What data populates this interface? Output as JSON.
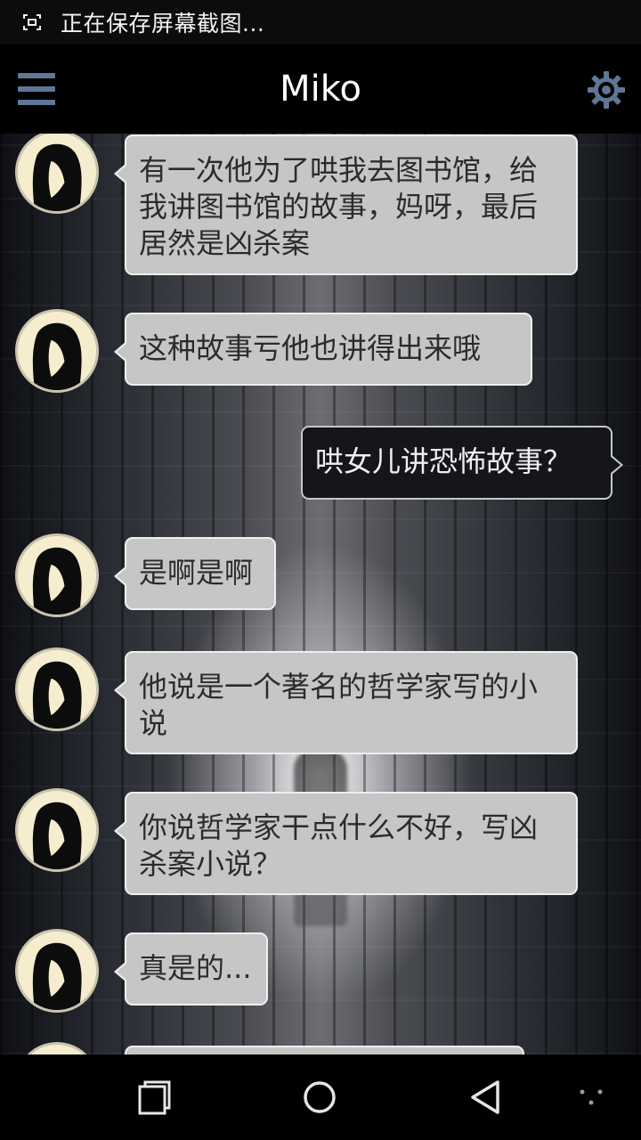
{
  "status_bar": {
    "text": "正在保存屏幕截图...",
    "icon": "screenshot-icon"
  },
  "app_bar": {
    "title": "Miko",
    "menu_icon": "hamburger-menu-icon",
    "settings_icon": "gear-icon",
    "accent_color": "#5f7796"
  },
  "messages": [
    {
      "sender": "miko",
      "text": "有一次他为了哄我去图书馆，给我讲图书馆的故事，妈呀，最后居然是凶杀案"
    },
    {
      "sender": "miko",
      "text": "这种故事亏他也讲得出来哦"
    },
    {
      "sender": "me",
      "text": "哄女儿讲恐怖故事？"
    },
    {
      "sender": "miko",
      "text": "是啊是啊"
    },
    {
      "sender": "miko",
      "text": "他说是一个著名的哲学家写的小说"
    },
    {
      "sender": "miko",
      "text": "你说哲学家干点什么不好，写凶杀案小说？"
    },
    {
      "sender": "miko",
      "text": "真是的..."
    },
    {
      "sender": "miko",
      "text": ""
    }
  ],
  "nav_bar": {
    "recents_icon": "recents-icon",
    "home_icon": "home-icon",
    "back_icon": "back-icon",
    "more_icon": "dots-icon"
  }
}
